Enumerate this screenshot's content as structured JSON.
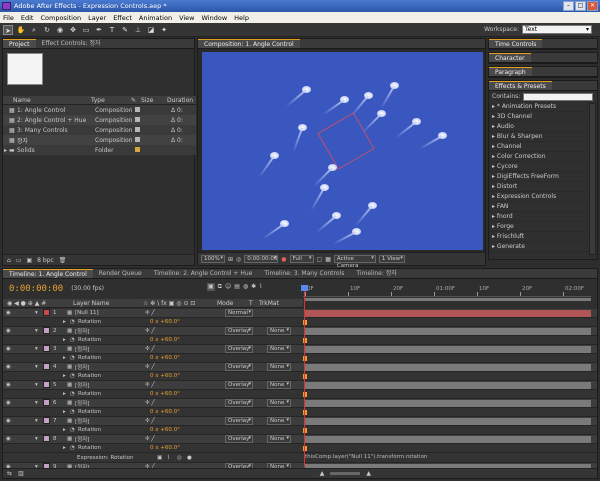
{
  "window": {
    "title": "Adobe After Effects - Expression Controls.aep *"
  },
  "menu": [
    "File",
    "Edit",
    "Composition",
    "Layer",
    "Effect",
    "Animation",
    "View",
    "Window",
    "Help"
  ],
  "workspace": {
    "label": "Workspace:",
    "value": "Text"
  },
  "project_panel": {
    "tabs": [
      "Project",
      "Effect Controls: 정자"
    ],
    "columns": [
      "Name",
      "Type",
      "Size",
      "Duration"
    ],
    "items": [
      {
        "name": "1: Angle Control",
        "type": "Composition",
        "duration": "Δ 0:",
        "color": "#b7b7b7"
      },
      {
        "name": "2: Angle Control + Hue",
        "type": "Composition",
        "duration": "Δ 0:",
        "color": "#b7b7b7"
      },
      {
        "name": "3: Many Controls",
        "type": "Composition",
        "duration": "Δ 0:",
        "color": "#b7b7b7"
      },
      {
        "name": "정자",
        "type": "Composition",
        "duration": "Δ 0:",
        "color": "#b7b7b7"
      },
      {
        "name": "Solids",
        "type": "Folder",
        "duration": "",
        "color": "#d8a640"
      }
    ],
    "footer": "8 bpc"
  },
  "composition_panel": {
    "tab": "Composition: 1. Angle Control",
    "zoom": "100%",
    "timecode": "0:00:00:00",
    "resolution": "Full",
    "camera": "Active Camera",
    "view": "1 View",
    "bg_color": "#3a57c0"
  },
  "right_panels": {
    "time_controls": "Time Controls",
    "character": "Character",
    "paragraph": "Paragraph",
    "effects_presets": "Effects & Presets",
    "contains_label": "Contains:",
    "effects": [
      "* Animation Presets",
      "3D Channel",
      "Audio",
      "Blur & Sharpen",
      "Channel",
      "Color Correction",
      "Cycore",
      "DigiEffects FreeForm",
      "Distort",
      "Expression Controls",
      "FAN",
      "fnord",
      "Forge",
      "Frischluft",
      "Generate"
    ]
  },
  "timeline": {
    "tabs": [
      "Timeline: 1. Angle Control",
      "Render Queue",
      "Timeline: 2. Angle Control + Hue",
      "Timeline: 3. Many Controls",
      "Timeline: 정자"
    ],
    "timecode": "0:00:00:00",
    "fps": "(30.00 fps)",
    "columns": {
      "layer_name": "Layer Name",
      "mode": "Mode",
      "t": "T",
      "trkmat": "TrkMat"
    },
    "ruler": [
      "0F",
      "10F",
      "20F",
      "01:00F",
      "10F",
      "20F",
      "02:00F"
    ],
    "rows": [
      {
        "kind": "layer",
        "num": "1",
        "name": "[Null 11]",
        "mode": "Normal",
        "trk": "",
        "color": "#c64a4a",
        "iconColor": "#ffffff"
      },
      {
        "kind": "prop",
        "name": "Rotation",
        "value": "0 x +60.0°"
      },
      {
        "kind": "layer",
        "num": "2",
        "name": "[정자]",
        "mode": "Overlay",
        "trk": "None",
        "color": "#c6a0c6"
      },
      {
        "kind": "prop",
        "name": "Rotation",
        "value": "0 x +60.0°"
      },
      {
        "kind": "layer",
        "num": "3",
        "name": "[정자]",
        "mode": "Overlay",
        "trk": "None",
        "color": "#c6a0c6"
      },
      {
        "kind": "prop",
        "name": "Rotation",
        "value": "0 x +60.0°"
      },
      {
        "kind": "layer",
        "num": "4",
        "name": "[정자]",
        "mode": "Overlay",
        "trk": "None",
        "color": "#c6a0c6"
      },
      {
        "kind": "prop",
        "name": "Rotation",
        "value": "0 x +60.0°"
      },
      {
        "kind": "layer",
        "num": "5",
        "name": "[정자]",
        "mode": "Overlay",
        "trk": "None",
        "color": "#c6a0c6"
      },
      {
        "kind": "prop",
        "name": "Rotation",
        "value": "0 x +60.0°"
      },
      {
        "kind": "layer",
        "num": "6",
        "name": "[정자]",
        "mode": "Overlay",
        "trk": "None",
        "color": "#c6a0c6"
      },
      {
        "kind": "prop",
        "name": "Rotation",
        "value": "0 x +60.0°"
      },
      {
        "kind": "layer",
        "num": "7",
        "name": "[정자]",
        "mode": "Overlay",
        "trk": "None",
        "color": "#c6a0c6"
      },
      {
        "kind": "prop",
        "name": "Rotation",
        "value": "0 x +60.0°"
      },
      {
        "kind": "layer",
        "num": "8",
        "name": "[정자]",
        "mode": "Overlay",
        "trk": "None",
        "color": "#c6a0c6"
      },
      {
        "kind": "prop",
        "name": "Rotation",
        "value": "0 x +60.0°"
      },
      {
        "kind": "expr",
        "name": "Expression: Rotation",
        "value": ""
      },
      {
        "kind": "layer",
        "num": "9",
        "name": "[정자]",
        "mode": "Overlay",
        "trk": "None",
        "color": "#c6a0c6"
      }
    ],
    "expression_text": "thisComp.layer(\"Null 11\").transform.rotation"
  }
}
